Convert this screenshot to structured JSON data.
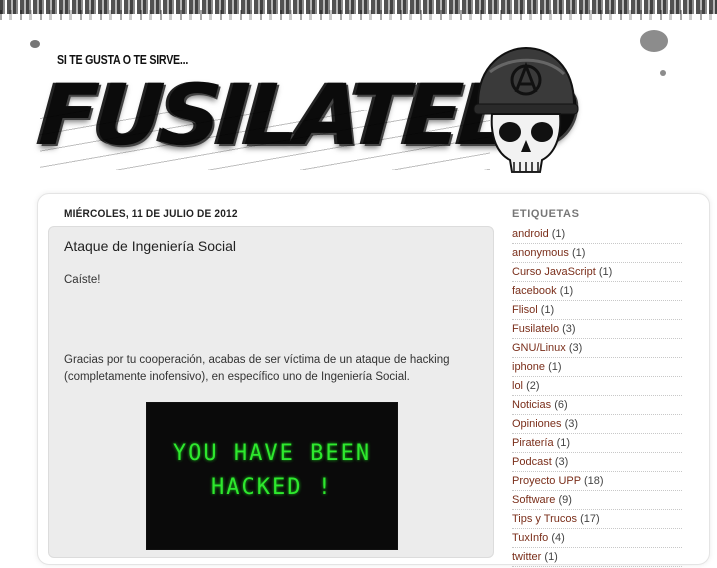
{
  "header": {
    "tagline": "SI TE GUSTA O TE SIRVE...",
    "title": "FUSILATELO"
  },
  "post": {
    "date_header": "MIÉRCOLES, 11 DE JULIO DE 2012",
    "title": "Ataque de Ingeniería Social",
    "paragraph1": "Caíste!",
    "paragraph2_line1": "Gracias por tu cooperación, acabas de ser víctima de un ataque de hacking",
    "paragraph2_line2": "(completamente inofensivo), en específico uno de Ingeniería Social.",
    "image_text": "YOU HAVE BEEN\nHACKED !"
  },
  "sidebar": {
    "title": "ETIQUETAS",
    "labels": [
      {
        "name": "android",
        "count": "(1)"
      },
      {
        "name": "anonymous",
        "count": "(1)"
      },
      {
        "name": "Curso JavaScript",
        "count": "(1)"
      },
      {
        "name": "facebook",
        "count": "(1)"
      },
      {
        "name": "Flisol",
        "count": "(1)"
      },
      {
        "name": "Fusilatelo",
        "count": "(3)"
      },
      {
        "name": "GNU/Linux",
        "count": "(3)"
      },
      {
        "name": "iphone",
        "count": "(1)"
      },
      {
        "name": "lol",
        "count": "(2)"
      },
      {
        "name": "Noticias",
        "count": "(6)"
      },
      {
        "name": "Opiniones",
        "count": "(3)"
      },
      {
        "name": "Piratería",
        "count": "(1)"
      },
      {
        "name": "Podcast",
        "count": "(3)"
      },
      {
        "name": "Proyecto UPP",
        "count": "(18)"
      },
      {
        "name": "Software",
        "count": "(9)"
      },
      {
        "name": "Tips y Trucos",
        "count": "(17)"
      },
      {
        "name": "TuxInfo",
        "count": "(4)"
      },
      {
        "name": "twitter",
        "count": "(1)"
      }
    ]
  },
  "colors": {
    "link": "#7a2e1a",
    "post_background": "#ececec",
    "hacked_text": "#2ee82e"
  },
  "icons": {
    "logo": "skull-helmet-icon"
  }
}
